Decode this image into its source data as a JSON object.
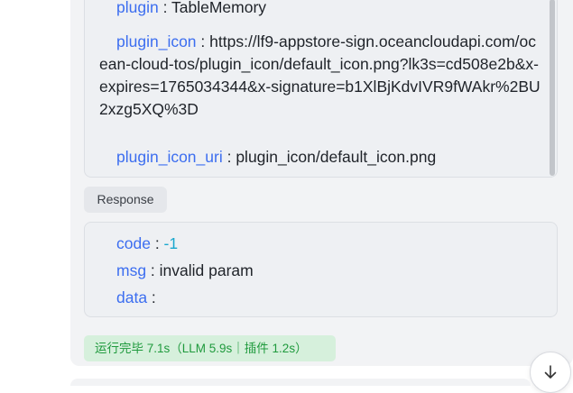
{
  "request_fields": [
    {
      "key": "plugin",
      "value": "TableMemory"
    },
    {
      "key": "plugin_icon",
      "value": "https://lf9-appstore-sign.oceancloudapi.com/ocean-cloud-tos/plugin_icon/default_icon.png?lk3s=cd508e2b&x-expires=1765034344&x-signature=b1XlBjKdvIVR9fWAkr%2BU2xzg5XQ%3D"
    },
    {
      "key": "plugin_icon_uri",
      "value": "plugin_icon/default_icon.png"
    }
  ],
  "response_tag": "Response",
  "response_fields": [
    {
      "key": "code",
      "value": "-1"
    },
    {
      "key": "msg",
      "value": "invalid param"
    },
    {
      "key": "data",
      "value": ""
    }
  ],
  "separator": " : ",
  "status_text": "运行完毕 7.1s（LLM 5.9s｜插件 1.2s）",
  "icons": {
    "scroll_down": "arrow-down-icon"
  },
  "colors": {
    "key": "#3c6ef0",
    "number": "#19a7ce",
    "status_bg": "#d6f0dc",
    "status_text": "#1f9a3d"
  }
}
